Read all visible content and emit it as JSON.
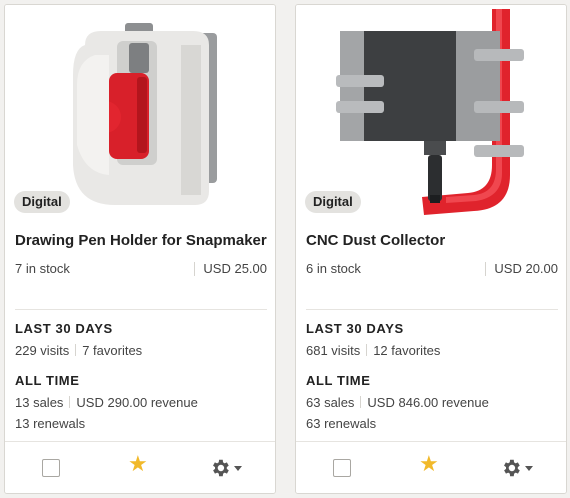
{
  "colors": {
    "accent_star": "#f1b92a",
    "card_border": "#d9d7d2",
    "background": "#f2f1ef"
  },
  "listings": [
    {
      "image": "pen-holder-render",
      "badge": "Digital",
      "title": "Drawing Pen Holder for Snapmaker",
      "stock": "7 in stock",
      "price": "USD 25.00",
      "last30_heading": "LAST 30 DAYS",
      "visits": "229 visits",
      "favorites": "7 favorites",
      "alltime_heading": "ALL TIME",
      "sales": "13 sales",
      "revenue": "USD 290.00 revenue",
      "renewals": "13 renewals",
      "selected": false,
      "starred": true,
      "icons": {
        "star": "star-icon",
        "settings": "gear-icon",
        "dropdown": "caret-down-icon"
      }
    },
    {
      "image": "cnc-dust-collector-render",
      "badge": "Digital",
      "title": "CNC Dust Collector",
      "stock": "6 in stock",
      "price": "USD 20.00",
      "last30_heading": "LAST 30 DAYS",
      "visits": "681 visits",
      "favorites": "12 favorites",
      "alltime_heading": "ALL TIME",
      "sales": "63 sales",
      "revenue": "USD 846.00 revenue",
      "renewals": "63 renewals",
      "selected": false,
      "starred": true,
      "icons": {
        "star": "star-icon",
        "settings": "gear-icon",
        "dropdown": "caret-down-icon"
      }
    }
  ]
}
